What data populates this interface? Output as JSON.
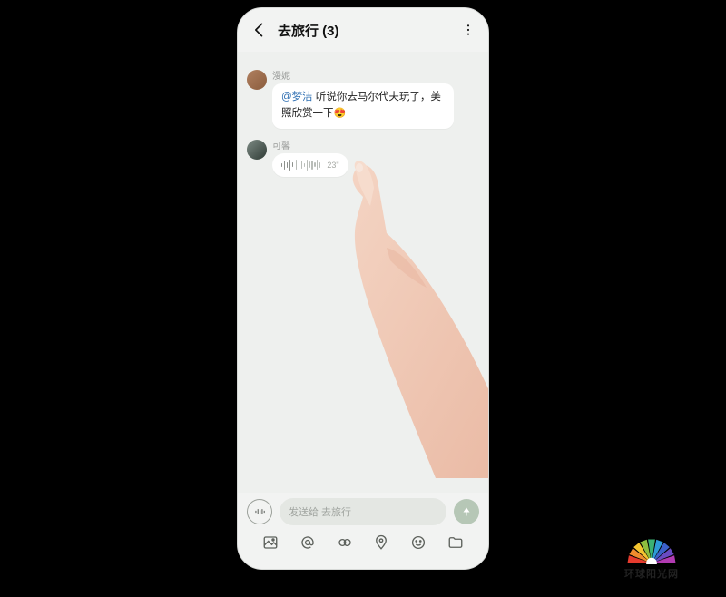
{
  "header": {
    "title": "去旅行 (3)"
  },
  "messages": [
    {
      "sender": "漫妮",
      "mention": "@梦洁",
      "text_after_mention": " 听说你去马尔代夫玩了，美照欣赏一下",
      "emoji": "😍"
    },
    {
      "sender": "可馨",
      "voice_duration": "23\""
    }
  ],
  "input": {
    "placeholder": "发送给 去旅行"
  },
  "watermark": {
    "text": "环球阳光网"
  }
}
